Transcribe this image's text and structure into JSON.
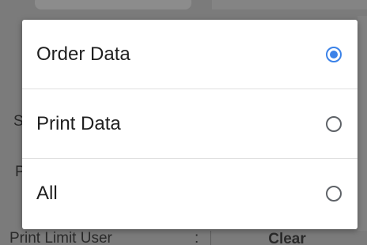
{
  "background": {
    "row_label": "Print Limit User",
    "row_colon": ":",
    "clear_button_label": "Clear",
    "partial_letter_1": "S",
    "partial_letter_2": "P"
  },
  "dialog": {
    "options": [
      {
        "label": "Order Data",
        "selected": true
      },
      {
        "label": "Print Data",
        "selected": false
      },
      {
        "label": "All",
        "selected": false
      }
    ],
    "accent_color": "#3b82e8"
  }
}
